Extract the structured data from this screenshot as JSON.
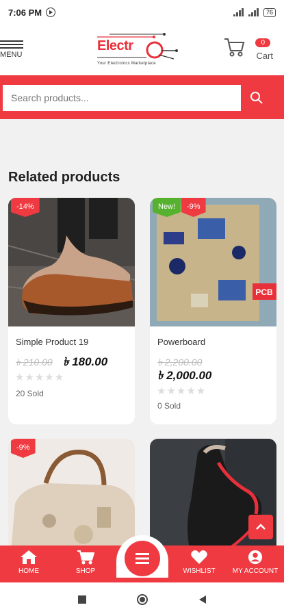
{
  "status_bar": {
    "time": "7:06 PM",
    "battery": "76"
  },
  "header": {
    "menu_label": "MENU",
    "logo_text": "Electr",
    "logo_tagline": "Your Electronics Marketplace",
    "cart_count": "0",
    "cart_label": "Cart"
  },
  "search": {
    "placeholder": "Search products..."
  },
  "section": {
    "title": "Related products"
  },
  "products": [
    {
      "name": "Simple Product 19",
      "old_price": "৳ 210.00",
      "new_price": "৳ 180.00",
      "sold": "20 Sold",
      "badges": [
        "-14%"
      ],
      "stars": "★★★★★"
    },
    {
      "name": "Powerboard",
      "old_price": "৳ 2,200.00",
      "new_price": "৳ 2,000.00",
      "sold": "0 Sold",
      "badges": [
        "New!",
        "-9%"
      ],
      "stars": "★★★★★",
      "image_text": "PCB"
    },
    {
      "badges": [
        "-9%"
      ]
    },
    {
      "badges": []
    }
  ],
  "bottom_nav": {
    "home": "HOME",
    "shop": "SHOP",
    "wishlist": "WISHLIST",
    "account": "MY ACCOUNT"
  },
  "colors": {
    "accent": "#ee3a40",
    "new_badge": "#56b22e"
  }
}
